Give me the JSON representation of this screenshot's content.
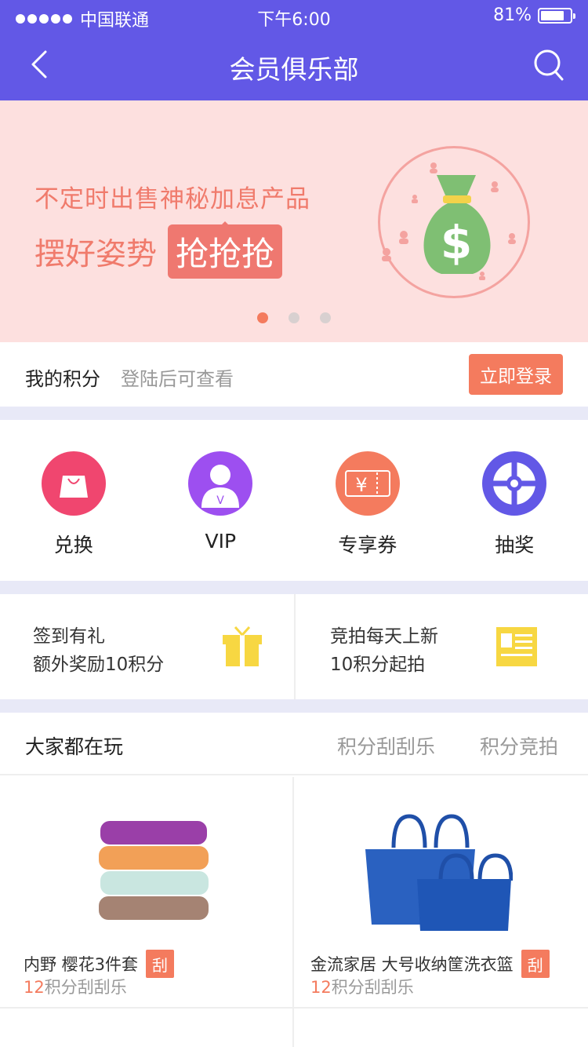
{
  "status": {
    "carrier": "中国联通",
    "time": "下午6:00",
    "battery": "81%"
  },
  "nav": {
    "title": "会员俱乐部"
  },
  "banner": {
    "line1": "不定时出售神秘加息产品",
    "line2_prefix": "摆好姿势",
    "line2_highlight": "抢抢抢",
    "pages": 3,
    "active_page": 1
  },
  "points": {
    "label": "我的积分",
    "hint": "登陆后可查看",
    "login_button": "立即登录"
  },
  "features": [
    {
      "label": "兑换",
      "icon": "shopping-bag-icon",
      "color": "#f0466f"
    },
    {
      "label": "VIP",
      "icon": "vip-user-icon",
      "color": "#9d4ff0"
    },
    {
      "label": "专享券",
      "icon": "coupon-icon",
      "color": "#f47b5e"
    },
    {
      "label": "抽奖",
      "icon": "lottery-wheel-icon",
      "color": "#6258e6"
    }
  ],
  "cards": [
    {
      "line1": "签到有礼",
      "line2": "额外奖励10积分",
      "icon": "gift-icon"
    },
    {
      "line1": "竞拍每天上新",
      "line2": "10积分起拍",
      "icon": "newspaper-icon"
    }
  ],
  "play": {
    "heading": "大家都在玩",
    "tabs": [
      "积分刮刮乐",
      "积分竞拍"
    ]
  },
  "goods": [
    {
      "name": "内野 樱花3件套",
      "tag": "刮",
      "price_num": "12",
      "price_text": "积分刮刮乐",
      "image": "towels"
    },
    {
      "name": "金流家居 大号收纳筐洗衣篮",
      "tag": "刮",
      "price_num": "12",
      "price_text": "积分刮刮乐",
      "image": "blue-baskets"
    }
  ],
  "colors": {
    "primary": "#6258e6",
    "accent": "#f47b5e",
    "banner_bg": "#fde0df"
  }
}
